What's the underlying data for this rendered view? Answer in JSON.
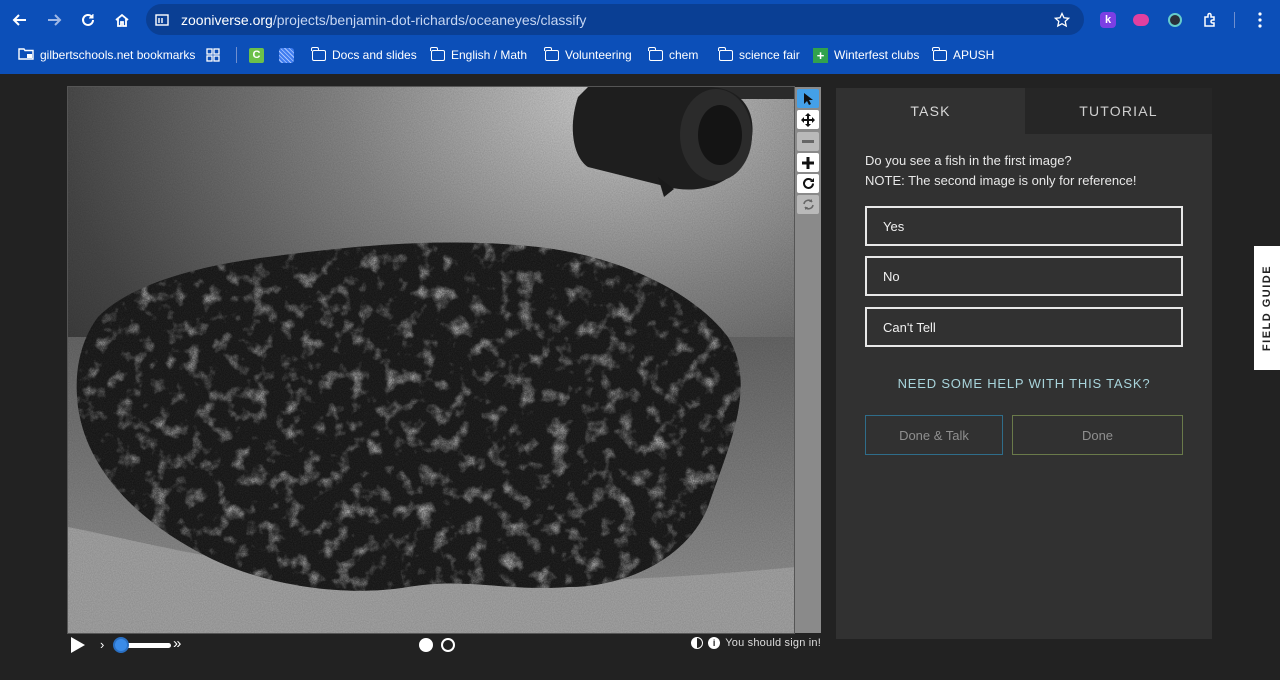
{
  "browser": {
    "url_host": "zooniverse.org",
    "url_path": "/projects/benjamin-dot-richards/oceaneyes/classify",
    "bookmarks": [
      {
        "label": "gilbertschools.net bookmarks",
        "icon": "managed-folder-icon"
      },
      {
        "label": "Docs and slides",
        "icon": "folder-icon"
      },
      {
        "label": "English / Math",
        "icon": "folder-icon"
      },
      {
        "label": "Volunteering",
        "icon": "folder-icon"
      },
      {
        "label": "chem",
        "icon": "folder-icon"
      },
      {
        "label": "science fair",
        "icon": "folder-icon"
      },
      {
        "label": "Winterfest clubs",
        "icon": "green-plus-icon"
      },
      {
        "label": "APUSH",
        "icon": "folder-icon"
      }
    ]
  },
  "viewer": {
    "tools": [
      "pointer-icon",
      "move-icon",
      "zoom-out-icon",
      "zoom-in-icon",
      "rotate-icon",
      "reset-icon"
    ],
    "frame_count": 2,
    "current_frame": 1,
    "signin_text": "You should sign in!"
  },
  "task": {
    "tabs": [
      {
        "label": "TASK"
      },
      {
        "label": "TUTORIAL"
      }
    ],
    "question_line1": "Do you see a fish in the first image?",
    "question_line2": "NOTE: The second image is only for reference!",
    "answers": [
      "Yes",
      "No",
      "Can't Tell"
    ],
    "help_link": "NEED SOME HELP WITH THIS TASK?",
    "done_talk_label": "Done & Talk",
    "done_label": "Done"
  },
  "field_guide_label": "FIELD GUIDE",
  "colors": {
    "browser_bar": "#0c4fb8",
    "page_bg": "#222222",
    "panel_bg": "#313131",
    "help_link": "#a8d4db",
    "active_tool": "#44a0e8"
  }
}
